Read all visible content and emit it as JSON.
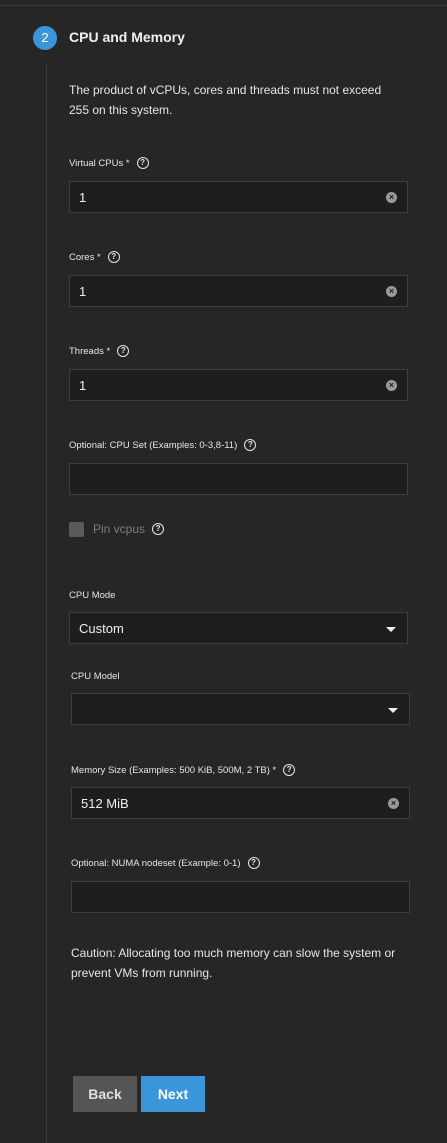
{
  "step": {
    "number": "2",
    "title": "CPU and Memory"
  },
  "info_text": "The product of vCPUs, cores and threads must not exceed 255 on this system.",
  "fields": {
    "vcpus": {
      "label": "Virtual CPUs *",
      "value": "1"
    },
    "cores": {
      "label": "Cores *",
      "value": "1"
    },
    "threads": {
      "label": "Threads *",
      "value": "1"
    },
    "cpu_set": {
      "label": "Optional: CPU Set (Examples: 0-3,8-11)",
      "value": ""
    },
    "pin_vcpus": {
      "label": "Pin vcpus",
      "checked": false,
      "disabled": true
    },
    "cpu_mode": {
      "label": "CPU Mode",
      "value": "Custom"
    },
    "cpu_model": {
      "label": "CPU Model",
      "value": ""
    },
    "memory_size": {
      "label": "Memory Size (Examples: 500 KiB, 500M, 2 TB) *",
      "value": "512 MiB"
    },
    "numa_nodeset": {
      "label": "Optional: NUMA nodeset (Example: 0-1)",
      "value": ""
    }
  },
  "caution_text": "Caution: Allocating too much memory can slow the system or prevent VMs from running.",
  "buttons": {
    "back": "Back",
    "next": "Next"
  },
  "icons": {
    "help": "?",
    "clear": "×"
  },
  "colors": {
    "accent": "#3b95d9",
    "background": "#262626",
    "input_bg": "#1e1e1e"
  }
}
